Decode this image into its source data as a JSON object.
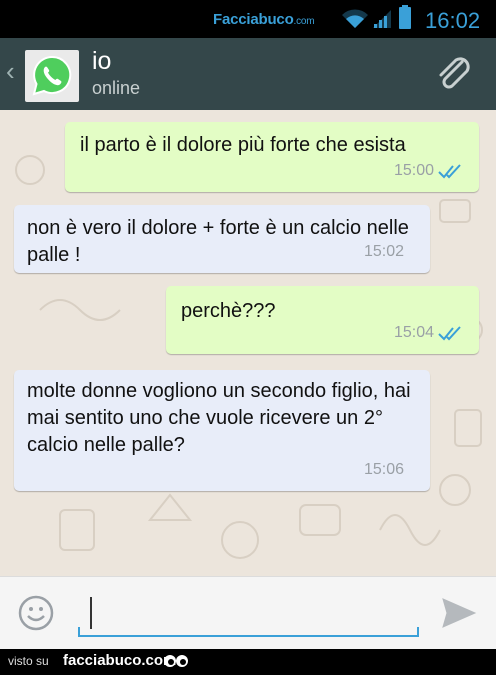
{
  "status_bar": {
    "watermark": "Facciabuco",
    "watermark_suffix": ".com",
    "time": "16:02",
    "icons": [
      "wifi-icon",
      "signal-icon",
      "battery-icon"
    ],
    "accent_color": "#3aa0d8"
  },
  "header": {
    "back_icon": "chevron-left-icon",
    "avatar_icon": "whatsapp-logo-icon",
    "contact_name": "io",
    "contact_status": "online",
    "attach_icon": "paperclip-icon",
    "background_color": "#34474a"
  },
  "messages": [
    {
      "direction": "outgoing",
      "text": "il parto è il dolore più forte che esista",
      "time": "15:00",
      "read": true
    },
    {
      "direction": "incoming",
      "text": "non è vero il dolore + forte è un calcio nelle palle !",
      "time": "15:02"
    },
    {
      "direction": "outgoing",
      "text": "perchè???",
      "time": "15:04",
      "read": true
    },
    {
      "direction": "incoming",
      "text": "molte donne vogliono un secondo figlio, hai mai sentito uno che vuole ricevere un 2° calcio nelle palle?",
      "time": "15:06"
    }
  ],
  "colors": {
    "outgoing_bubble": "#e3fdc5",
    "incoming_bubble": "#e8edf9",
    "chat_background": "#ece5dc",
    "read_ticks": "#3aa0d8"
  },
  "composer": {
    "emoji_icon": "smiley-icon",
    "input_value": "",
    "send_icon": "send-icon"
  },
  "footer": {
    "prefix": "visto su",
    "brand": "facciabuco.com",
    "logo_icon": "eyes-icon"
  }
}
